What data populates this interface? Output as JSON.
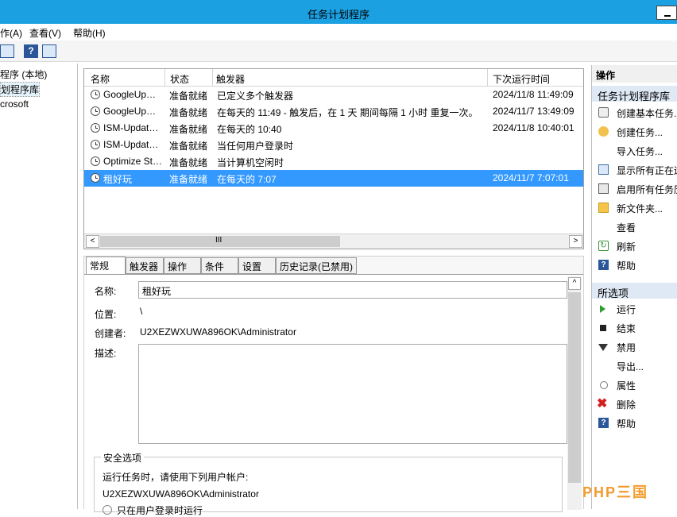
{
  "window": {
    "title": "任务计划程序"
  },
  "menu": [
    "作(A)",
    "查看(V)",
    "帮助(H)"
  ],
  "tree": [
    "程序 (本地)",
    "划程序库",
    "crosoft"
  ],
  "task_list": {
    "columns": [
      "名称",
      "状态",
      "触发器",
      "下次运行时间"
    ],
    "rows": [
      {
        "name": "GoogleUp…",
        "status": "准备就绪",
        "trigger": "已定义多个触发器",
        "next": "2024/11/8 11:49:09"
      },
      {
        "name": "GoogleUp…",
        "status": "准备就绪",
        "trigger": "在每天的 11:49 - 触发后，在 1 天 期间每隔 1 小时 重复一次。",
        "next": "2024/11/7 13:49:09"
      },
      {
        "name": "ISM-Updat…",
        "status": "准备就绪",
        "trigger": "在每天的 10:40",
        "next": "2024/11/8 10:40:01"
      },
      {
        "name": "ISM-Updat…",
        "status": "准备就绪",
        "trigger": "当任何用户登录时",
        "next": ""
      },
      {
        "name": "Optimize St…",
        "status": "准备就绪",
        "trigger": "当计算机空闲时",
        "next": ""
      },
      {
        "name": "租好玩",
        "status": "准备就绪",
        "trigger": "在每天的 7:07",
        "next": "2024/11/7 7:07:01"
      }
    ],
    "selected_index": 5,
    "hscroll_label": "III"
  },
  "detail": {
    "tabs": [
      "常规",
      "触发器",
      "操作",
      "条件",
      "设置",
      "历史记录(已禁用)"
    ],
    "name_label": "名称:",
    "name_value": "租好玩",
    "location_label": "位置:",
    "location_value": "\\",
    "author_label": "创建者:",
    "author_value": "U2XEZWXUWA896OK\\Administrator",
    "desc_label": "描述:",
    "security_legend": "安全选项",
    "run_as_text": "运行任务时，请使用下列用户帐户:",
    "run_as_user": "U2XEZWXUWA896OK\\Administrator",
    "option_text": "只在用户登录时运行"
  },
  "actions": {
    "header": "操作",
    "section1": "任务计划程序库",
    "items1": [
      {
        "label": "创建基本任务...",
        "icon": "wizard-icon"
      },
      {
        "label": "创建任务...",
        "icon": "task-icon"
      },
      {
        "label": "导入任务...",
        "icon": ""
      },
      {
        "label": "显示所有正在运",
        "icon": "list-icon"
      },
      {
        "label": "启用所有任务历",
        "icon": "history-icon"
      },
      {
        "label": "新文件夹...",
        "icon": "folder-icon"
      },
      {
        "label": "查看",
        "icon": ""
      },
      {
        "label": "刷新",
        "icon": "refresh-icon"
      },
      {
        "label": "帮助",
        "icon": "help-icon"
      }
    ],
    "section2": "所选项",
    "items2": [
      {
        "label": "运行",
        "icon": "run-icon"
      },
      {
        "label": "结束",
        "icon": "stop-icon"
      },
      {
        "label": "禁用",
        "icon": "disable-icon"
      },
      {
        "label": "导出...",
        "icon": ""
      },
      {
        "label": "属性",
        "icon": "properties-icon"
      },
      {
        "label": "删除",
        "icon": "delete-icon"
      },
      {
        "label": "帮助",
        "icon": "help-icon"
      }
    ]
  },
  "watermark": "PHP三国"
}
